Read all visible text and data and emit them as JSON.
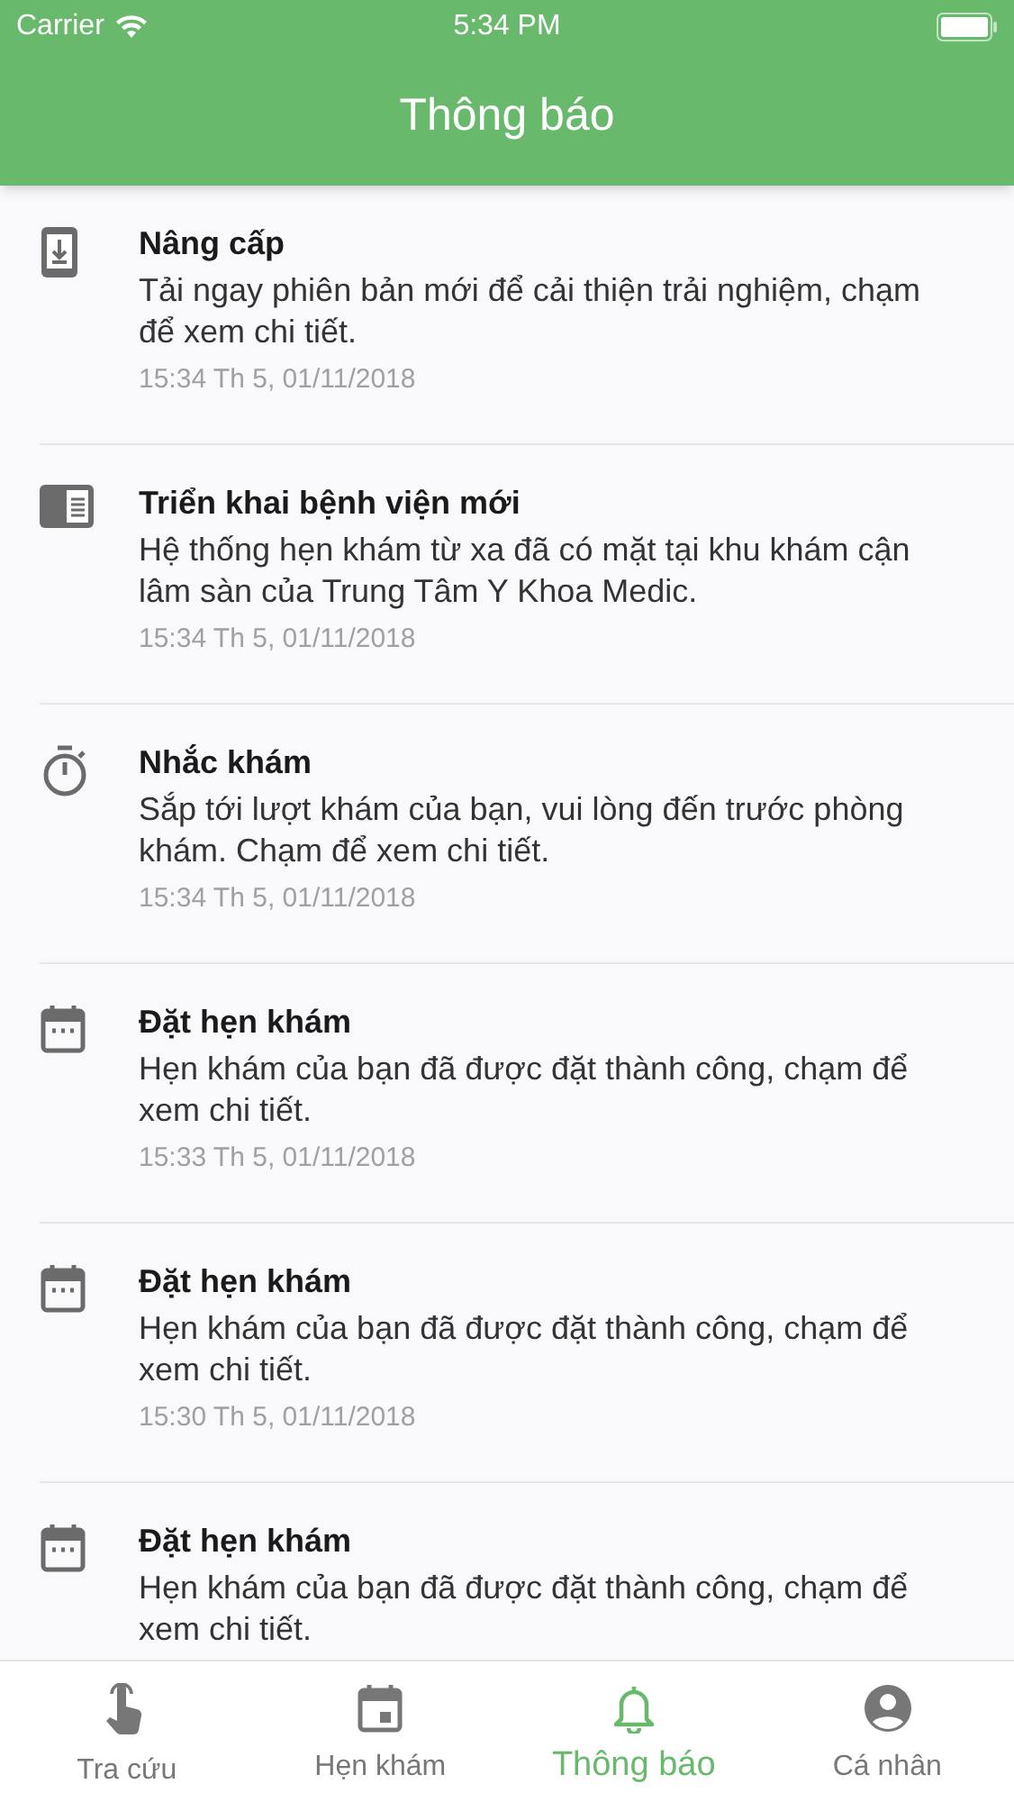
{
  "status_bar": {
    "carrier": "Carrier",
    "time": "5:34 PM"
  },
  "header": {
    "title": "Thông báo"
  },
  "notifications": [
    {
      "kind": "update",
      "title": "Nâng cấp",
      "body": "Tải ngay phiên bản mới để cải thiện trải nghiệm, chạm để xem chi tiết.",
      "time": "15:34 Th 5, 01/11/2018"
    },
    {
      "kind": "hospital",
      "title": "Triển khai bệnh viện mới",
      "body": "Hệ thống hẹn khám từ xa đã có mặt tại khu khám cận lâm sàn của Trung Tâm Y Khoa Medic.",
      "time": "15:34 Th 5, 01/11/2018"
    },
    {
      "kind": "reminder",
      "title": "Nhắc khám",
      "body": "Sắp tới lượt khám của bạn, vui lòng đến trước phòng khám. Chạm để xem chi tiết.",
      "time": "15:34 Th 5, 01/11/2018"
    },
    {
      "kind": "booking",
      "title": "Đặt hẹn khám",
      "body": "Hẹn khám của bạn đã được đặt thành công, chạm để xem chi tiết.",
      "time": "15:33 Th 5, 01/11/2018"
    },
    {
      "kind": "booking",
      "title": "Đặt hẹn khám",
      "body": "Hẹn khám của bạn đã được đặt thành công, chạm để xem chi tiết.",
      "time": "15:30 Th 5, 01/11/2018"
    },
    {
      "kind": "booking",
      "title": "Đặt hẹn khám",
      "body": "Hẹn khám của bạn đã được đặt thành công, chạm để xem chi tiết."
    }
  ],
  "tabs": [
    {
      "kind": "lookup",
      "label": "Tra cứu",
      "selected": false
    },
    {
      "kind": "appointments",
      "label": "Hẹn khám",
      "selected": false
    },
    {
      "kind": "notifications",
      "label": "Thông báo",
      "selected": true
    },
    {
      "kind": "profile",
      "label": "Cá nhân",
      "selected": false
    }
  ]
}
